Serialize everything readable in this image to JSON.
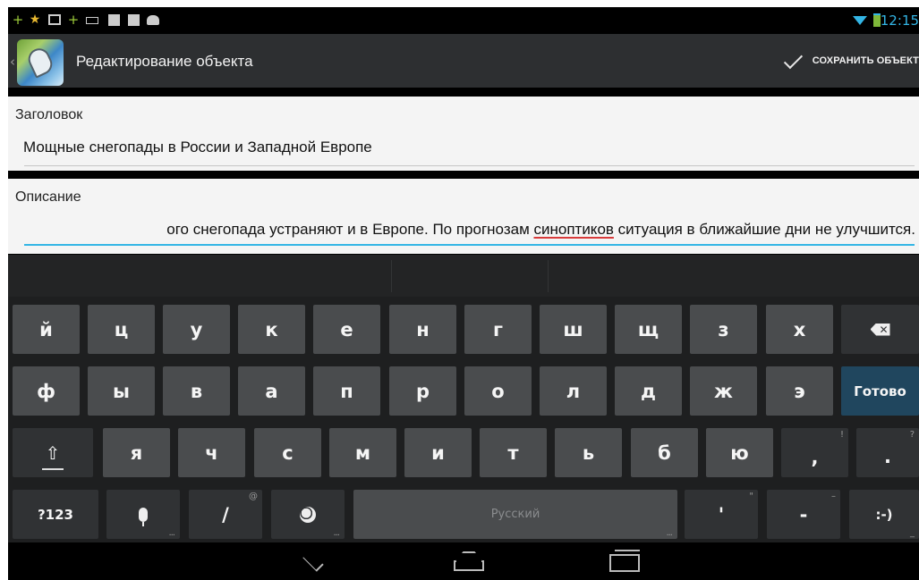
{
  "status_bar": {
    "time": "12:15",
    "left_icons": [
      "plus-icon",
      "star-icon",
      "image-icon",
      "plus-icon",
      "keyboard-icon",
      "store-bag-icon",
      "store-bag-icon",
      "android-icon"
    ],
    "right_icons": [
      "wifi-icon",
      "battery-charging-icon"
    ]
  },
  "action_bar": {
    "title": "Редактирование объекта",
    "save_label": "СОХРАНИТЬ ОБЪЕКТ",
    "icons": [
      "up-chevron-icon",
      "map-pin-app-icon",
      "check-icon"
    ]
  },
  "form": {
    "title_label": "Заголовок",
    "title_value": "Мощные снегопады в России и Западной Европе",
    "description_label": "Описание",
    "description_before": "ого снегопада устраняют и в Европе. По прогнозам ",
    "description_misspelled": "синоптиков",
    "description_after": " ситуация в ближайшие дни не улучшится."
  },
  "keyboard": {
    "row1": [
      "й",
      "ц",
      "у",
      "к",
      "е",
      "н",
      "г",
      "ш",
      "щ",
      "з",
      "х"
    ],
    "row2": [
      "ф",
      "ы",
      "в",
      "а",
      "п",
      "р",
      "о",
      "л",
      "д",
      "ж",
      "э"
    ],
    "done_label": "Готово",
    "row3": [
      "я",
      "ч",
      "с",
      "м",
      "и",
      "т",
      "ь",
      "б",
      "ю"
    ],
    "comma": ",",
    "comma_hint": "!",
    "period": ".",
    "period_hint": "?",
    "symbols_label": "?123",
    "slash": "/",
    "slash_hint": "@",
    "space_label": "Русский",
    "apostrophe": "'",
    "apostrophe_hint": "\"",
    "dash": "-",
    "dash_hint": "–",
    "smiley": ":-)",
    "icons": [
      "backspace-icon",
      "shift-icon",
      "microphone-icon",
      "globe-icon"
    ]
  },
  "nav_bar": {
    "icons": [
      "back-icon",
      "home-icon",
      "recents-icon"
    ]
  }
}
